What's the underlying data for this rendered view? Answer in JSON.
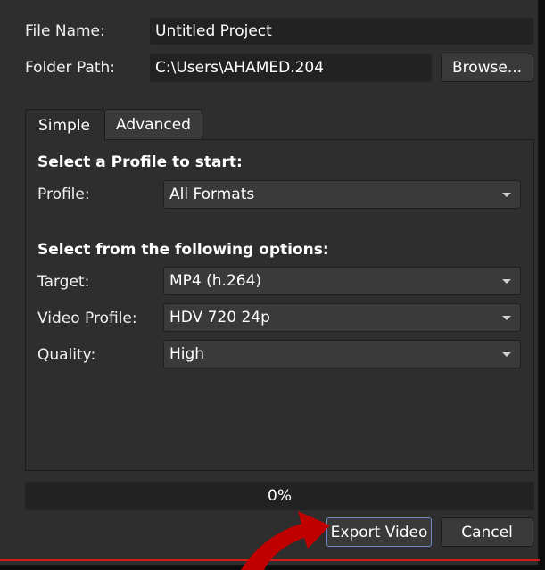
{
  "file": {
    "label": "File Name:",
    "value": "Untitled Project"
  },
  "folder": {
    "label": "Folder Path:",
    "value": "C:\\Users\\AHAMED.204",
    "browse_label": "Browse..."
  },
  "tabs": [
    {
      "label": "Simple",
      "active": true
    },
    {
      "label": "Advanced",
      "active": false
    }
  ],
  "simple": {
    "profile_section_title": "Select a Profile to start:",
    "profile_label": "Profile:",
    "profile_value": "All Formats",
    "options_section_title": "Select from the following options:",
    "target_label": "Target:",
    "target_value": "MP4 (h.264)",
    "video_profile_label": "Video Profile:",
    "video_profile_value": "HDV 720 24p",
    "quality_label": "Quality:",
    "quality_value": "High"
  },
  "progress": {
    "text": "0%",
    "value": 0
  },
  "actions": {
    "export_label": "Export Video",
    "cancel_label": "Cancel"
  },
  "colors": {
    "background": "#2e2e2e",
    "field": "#222222",
    "button": "#3a3a3a",
    "accent_focus": "#6a8cc7",
    "annotation_arrow": "#c00000"
  },
  "icons": [
    "chevron-down-icon",
    "annotation-arrow-icon"
  ]
}
